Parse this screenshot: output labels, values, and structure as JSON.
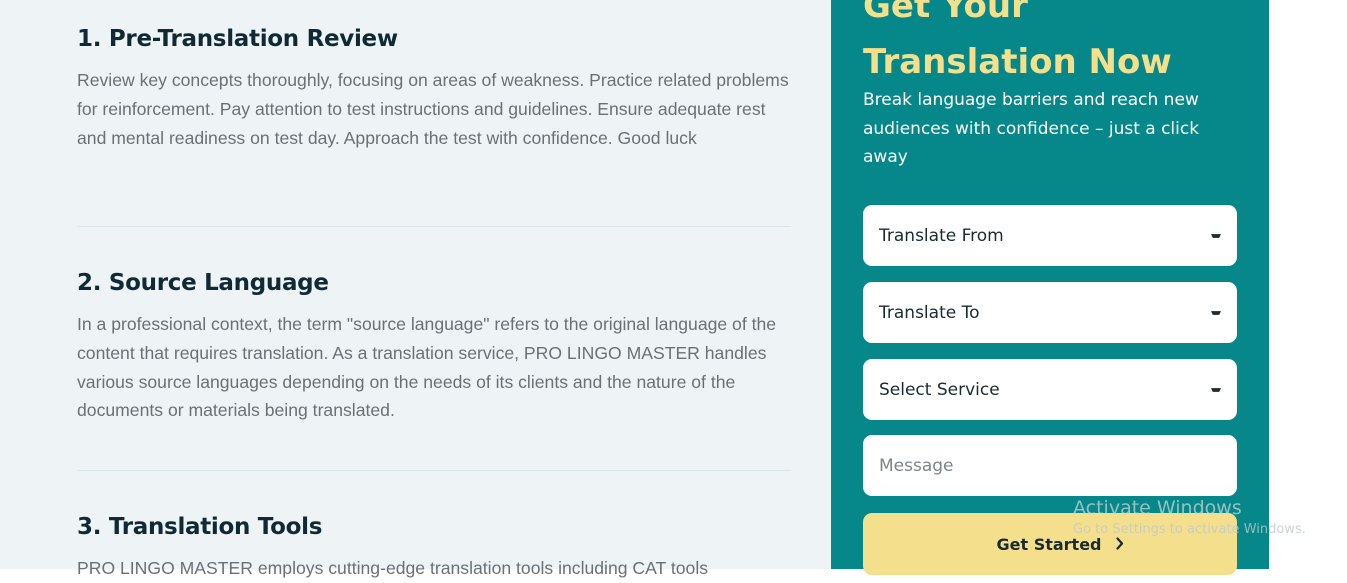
{
  "sections": [
    {
      "title": "1. Pre-Translation Review",
      "body": "Review key concepts thoroughly, focusing on areas of weakness. Practice related problems for reinforcement. Pay attention to test instructions and guidelines. Ensure adequate rest and mental readiness on test day. Approach the test with confidence. Good luck"
    },
    {
      "title": "2. Source Language",
      "body": "In a professional context, the term \"source language\" refers to the original language of the content that requires translation. As a translation service, PRO LINGO MASTER handles various source languages depending on the needs of its clients and the nature of the documents or materials being translated."
    },
    {
      "title": "3. Translation Tools",
      "body": "PRO LINGO MASTER employs cutting-edge translation tools including CAT tools"
    }
  ],
  "panel": {
    "title": "Get Your Translation Now",
    "subtitle": "Break language barriers and reach new audiences with confidence – just a click away",
    "translate_from": "Translate From",
    "translate_to": "Translate To",
    "select_service": "Select Service",
    "message_placeholder": "Message",
    "button_label": "Get Started"
  },
  "watermark": {
    "title": "Activate Windows",
    "subtitle": "Go to Settings to activate Windows."
  },
  "colors": {
    "panel_bg": "#06888a",
    "accent_yellow": "#f4e08c",
    "heading": "#0f2a35",
    "body_text": "#6b7074",
    "content_bg": "#eef4f6"
  }
}
